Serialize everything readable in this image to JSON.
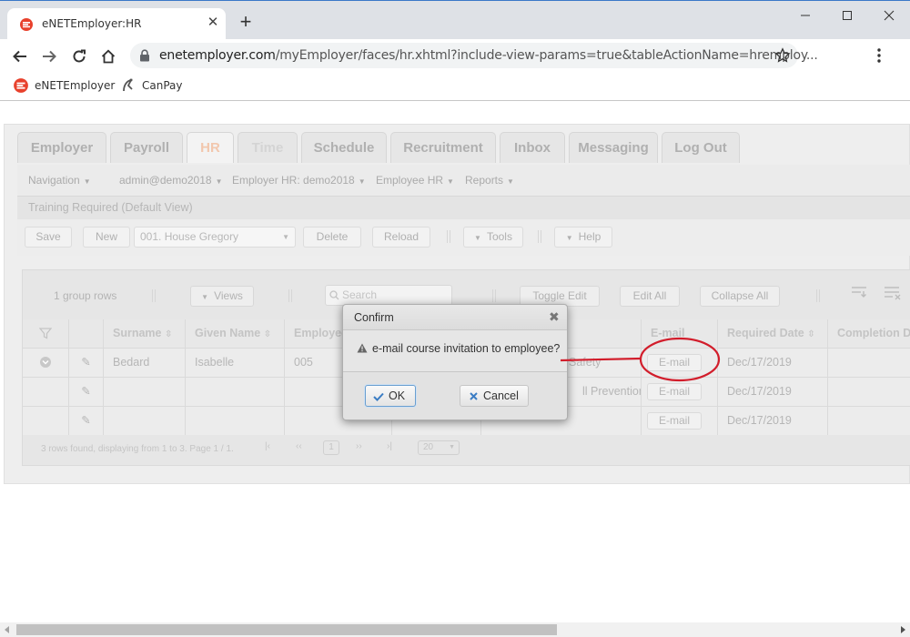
{
  "browser": {
    "tab_title": "eNETEmployer:HR",
    "url_host": "enetemployer.com",
    "url_path": "/myEmployer/faces/hr.xhtml?include-view-params=true&tableActionName=hremploy...",
    "bookmarks": [
      {
        "label": "eNETEmployer",
        "icon": "enet-logo-icon"
      },
      {
        "label": "CanPay",
        "icon": "canpay-icon"
      }
    ]
  },
  "nav_tabs": [
    "Employer",
    "Payroll",
    "HR",
    "Time",
    "Schedule",
    "Recruitment",
    "Inbox",
    "Messaging",
    "Log Out"
  ],
  "menu": {
    "navigation": "Navigation",
    "user": "admin@demo2018",
    "employer": "Employer HR: demo2018",
    "employee": "Employee HR",
    "reports": "Reports"
  },
  "panel_title": "Training Required (Default View)",
  "actions": {
    "save": "Save",
    "new": "New",
    "employee_select": "001. House Gregory",
    "delete": "Delete",
    "reload": "Reload",
    "tools": "Tools",
    "help": "Help"
  },
  "grid": {
    "group_rows": "1 group rows",
    "views": "Views",
    "search_placeholder": "Search",
    "toggle_edit": "Toggle Edit",
    "edit_all": "Edit All",
    "collapse_all": "Collapse All",
    "columns": [
      "Surname",
      "Given Name",
      "Employee",
      "E-mail",
      "Required Date",
      "Completion Date"
    ],
    "rows": [
      {
        "surname": "Bedard",
        "given": "Isabelle",
        "employee": "005",
        "course": "Safety",
        "email": "E-mail",
        "required": "Dec/17/2019"
      },
      {
        "surname": "",
        "given": "",
        "employee": "",
        "course": "ll Prevention",
        "email": "E-mail",
        "required": "Dec/17/2019"
      },
      {
        "surname": "",
        "given": "",
        "employee": "",
        "course": "",
        "email": "E-mail",
        "required": "Dec/17/2019"
      }
    ],
    "footer": "3 rows found, displaying from 1 to 3. Page 1 / 1.",
    "page_number": "1",
    "page_size": "20"
  },
  "dialog": {
    "title": "Confirm",
    "message": "e-mail course invitation to employee?",
    "ok": "OK",
    "cancel": "Cancel"
  },
  "colors": {
    "accent_red": "#d6001c",
    "annotation": "#d21d2b",
    "ok_border": "#6a9fd0"
  }
}
